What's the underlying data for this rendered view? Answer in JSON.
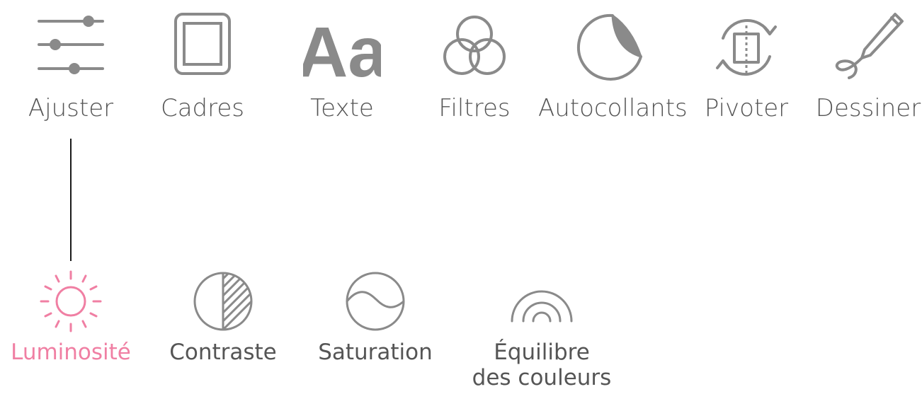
{
  "colors": {
    "icon_gray": "#8a8a8a",
    "text_gray": "#555555",
    "active_pink": "#f07fa3",
    "connector": "#1a1a1a"
  },
  "tools": [
    {
      "label": "Ajuster",
      "icon": "sliders-icon"
    },
    {
      "label": "Cadres",
      "icon": "frame-icon"
    },
    {
      "label": "Texte",
      "icon": "text-icon",
      "glyph": "Aa"
    },
    {
      "label": "Filtres",
      "icon": "filters-icon"
    },
    {
      "label": "Autocollants",
      "icon": "sticker-icon"
    },
    {
      "label": "Pivoter",
      "icon": "rotate-icon"
    },
    {
      "label": "Dessiner",
      "icon": "pen-icon"
    }
  ],
  "adjust": {
    "active": "Luminosité",
    "items": [
      {
        "label": "Luminosité",
        "icon": "brightness-icon"
      },
      {
        "label": "Contraste",
        "icon": "contrast-icon"
      },
      {
        "label": "Saturation",
        "icon": "saturation-icon"
      },
      {
        "label_line1": "Équilibre",
        "label_line2": "des couleurs",
        "icon": "color-balance-icon"
      }
    ]
  }
}
